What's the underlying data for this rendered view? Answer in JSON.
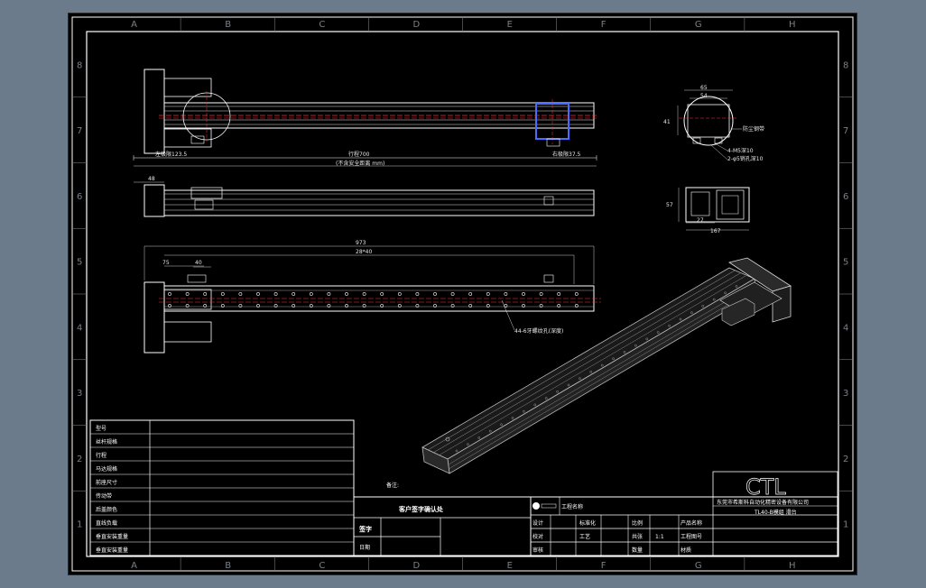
{
  "zones": {
    "columns": [
      "A",
      "B",
      "C",
      "D",
      "E",
      "F",
      "G",
      "H"
    ],
    "rows": [
      "8",
      "7",
      "6",
      "5",
      "4",
      "3",
      "2",
      "1"
    ]
  },
  "top_view": {
    "dim_left": "左极限123.5",
    "dim_stroke": "行程700",
    "dim_right": "右极限37.5",
    "dim_total": "(不含安全距离 mm)"
  },
  "side_view": {
    "dim_small": "48"
  },
  "bottom_view": {
    "dim_total": "973",
    "dim_holes": "28*40",
    "dim_left": "75",
    "dim_pitch": "40",
    "hole_note": "44-6牙螺纹孔(深度)"
  },
  "end_view": {
    "dim_top_a": "65",
    "dim_top_b": "54",
    "dim_side": "41",
    "note_1": "防尘钢带",
    "note_2": "4-M5深10",
    "note_3": "2-φ5销孔深10"
  },
  "section_view": {
    "dim_height": "57",
    "dim_inner": "27",
    "dim_width": "167"
  },
  "remark_label": "备注:",
  "spec_table": {
    "rows": [
      "型号",
      "丝杆规格",
      "行程",
      "马达规格",
      "前座尺寸",
      "传动带",
      "后盖颜色",
      "直线负载",
      "垂直安装重量",
      "垂直安装重量"
    ]
  },
  "customer_confirm": {
    "title": "客户签字确认处",
    "sign": "签字",
    "date": "日期"
  },
  "title_block": {
    "logo": "CTL",
    "company": "东莞市希斯科自动化精密设备有限公司",
    "model": "TL40-B模组 滑台",
    "project_label": "工程名称",
    "design": "设计",
    "standard": "标准化",
    "scale_label": "比例",
    "scale_value": "1:1",
    "product_name": "产品名称",
    "check": "校对",
    "craft": "工艺",
    "approve": "审核",
    "date": "日期",
    "sheet": "共张",
    "quantity": "数量",
    "drawing_no": "工程图号",
    "material": "材质"
  }
}
